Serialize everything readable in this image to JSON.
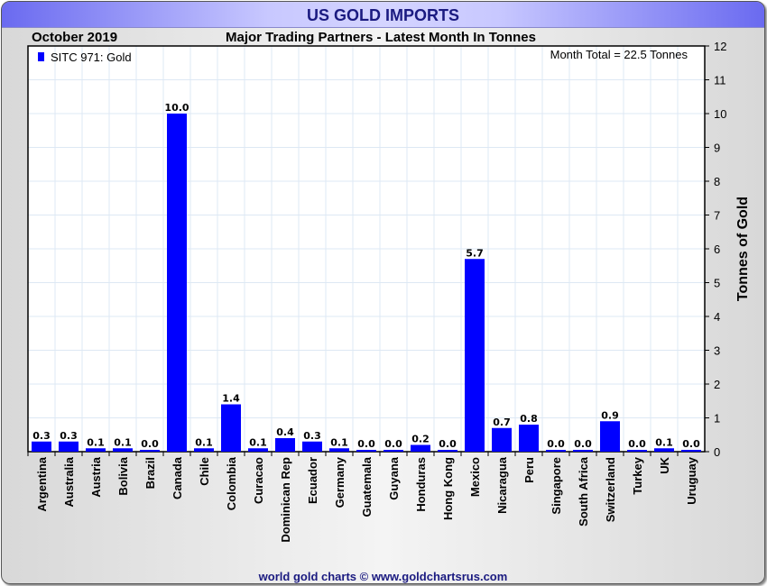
{
  "header": {
    "title": "US GOLD IMPORTS",
    "period": "October 2019",
    "subtitle": "Major Trading Partners - Latest Month In Tonnes"
  },
  "footer": "world gold charts © www.goldchartsrus.com",
  "colors": {
    "bar": "#0000ff",
    "grid": "#dde8f4",
    "title": "#1a1a80"
  },
  "chart_data": {
    "type": "bar",
    "title": "Major Trading Partners - Latest Month In Tonnes",
    "legend": {
      "label": "SITC 971: Gold",
      "position": "top-left"
    },
    "annotation": "Month Total = 22.5 Tonnes",
    "ylabel": "Tonnes of Gold",
    "xlabel": "",
    "ylim": [
      0,
      12
    ],
    "yticks": [
      0,
      1,
      2,
      3,
      4,
      5,
      6,
      7,
      8,
      9,
      10,
      11,
      12
    ],
    "grid": true,
    "categories": [
      "Argentina",
      "Australia",
      "Austria",
      "Bolivia",
      "Brazil",
      "Canada",
      "Chile",
      "Colombia",
      "Curacao",
      "Dominican Rep",
      "Ecuador",
      "Germany",
      "Guatemala",
      "Guyana",
      "Honduras",
      "Hong Kong",
      "Mexico",
      "Nicaragua",
      "Peru",
      "Singapore",
      "South Africa",
      "Switzerland",
      "Turkey",
      "UK",
      "Uruguay"
    ],
    "values": [
      0.3,
      0.3,
      0.1,
      0.1,
      0.0,
      10.0,
      0.1,
      1.4,
      0.1,
      0.4,
      0.3,
      0.1,
      0.0,
      0.0,
      0.2,
      0.0,
      5.7,
      0.7,
      0.8,
      0.0,
      0.0,
      0.9,
      0.0,
      0.1,
      0.0
    ]
  }
}
